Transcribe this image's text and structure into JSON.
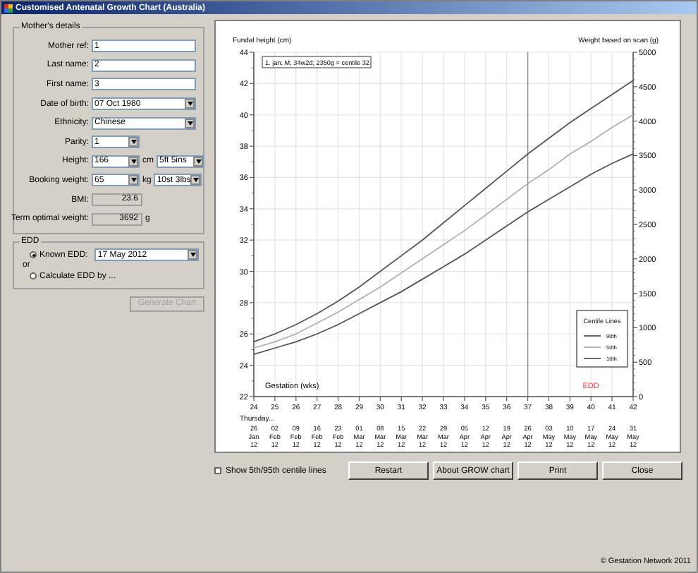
{
  "window": {
    "title": "Customised Antenatal Growth Chart (Australia)"
  },
  "mothers_details": {
    "title": "Mother's details",
    "fields": [
      {
        "kind": "text",
        "label": "Mother ref:",
        "value": "1"
      },
      {
        "kind": "text",
        "label": "Last name:",
        "value": "2"
      },
      {
        "kind": "text",
        "label": "First name:",
        "value": "3"
      },
      {
        "kind": "dropdown",
        "label": "Date of birth:",
        "value": "07 Oct 1980"
      },
      {
        "kind": "dropdown",
        "label": "Ethnicity:",
        "value": "Chinese"
      },
      {
        "kind": "short-dropdown",
        "label": "Parity:",
        "value": "1"
      },
      {
        "kind": "short-dropdown",
        "label": "Height:",
        "value": "166",
        "unit": "cm",
        "secondary": "5ft 5ins"
      },
      {
        "kind": "short-dropdown",
        "label": "Booking weight:",
        "value": "65",
        "unit": "kg",
        "secondary": "10st 3lbs"
      },
      {
        "kind": "readonly",
        "label": "BMI:",
        "value": "23.6"
      },
      {
        "kind": "readonly",
        "label": "Term optimal weight:",
        "value": "3692",
        "unit": "g"
      }
    ]
  },
  "edd": {
    "title": "EDD",
    "separator": "or",
    "options": [
      {
        "label": "Known EDD:",
        "selected": true,
        "value": "17 May 2012"
      },
      {
        "label": "Calculate EDD by ...",
        "selected": false
      }
    ]
  },
  "generate_button": {
    "label": "Generate Chart",
    "disabled": true
  },
  "chart": {
    "right_axis": {
      "label": "Weight based on scan (g)",
      "ticks": [
        "5000",
        "4500",
        "4000",
        "3500",
        "3000",
        "2500",
        "2000",
        "1500",
        "1000",
        "500",
        "0"
      ]
    },
    "legend_title": "Centile Lines",
    "dates_label": "Thursday...",
    "dates": [
      {
        "day": "26",
        "month": "Jan",
        "year": "12"
      },
      {
        "day": "02",
        "month": "Feb",
        "year": "12"
      },
      {
        "day": "09",
        "month": "Feb",
        "year": "12"
      },
      {
        "day": "16",
        "month": "Feb",
        "year": "12"
      },
      {
        "day": "23",
        "month": "Feb",
        "year": "12"
      },
      {
        "day": "01",
        "month": "Mar",
        "year": "12"
      },
      {
        "day": "08",
        "month": "Mar",
        "year": "12"
      },
      {
        "day": "15",
        "month": "Mar",
        "year": "12"
      },
      {
        "day": "22",
        "month": "Mar",
        "year": "12"
      },
      {
        "day": "29",
        "month": "Mar",
        "year": "12"
      },
      {
        "day": "05",
        "month": "Apr",
        "year": "12"
      },
      {
        "day": "12",
        "month": "Apr",
        "year": "12"
      },
      {
        "day": "19",
        "month": "Apr",
        "year": "12"
      },
      {
        "day": "26",
        "month": "Apr",
        "year": "12"
      },
      {
        "day": "03",
        "month": "May",
        "year": "12"
      },
      {
        "day": "10",
        "month": "May",
        "year": "12"
      },
      {
        "day": "17",
        "month": "May",
        "year": "12"
      },
      {
        "day": "24",
        "month": "May",
        "year": "12"
      },
      {
        "day": "31",
        "month": "May",
        "year": "12"
      }
    ],
    "chart_data": {
      "type": "line",
      "xlabel": "Gestation (wks)",
      "ylabel": "Fundal height (cm)",
      "x": [
        24,
        25,
        26,
        27,
        28,
        29,
        30,
        31,
        32,
        33,
        34,
        35,
        36,
        37,
        38,
        39,
        40,
        41,
        42
      ],
      "series": [
        {
          "name": "90th",
          "color": "#555555",
          "values": [
            25.5,
            26.0,
            26.6,
            27.3,
            28.1,
            29.0,
            30.0,
            31.0,
            32.0,
            33.1,
            34.2,
            35.3,
            36.4,
            37.5,
            38.5,
            39.5,
            40.4,
            41.3,
            42.2
          ]
        },
        {
          "name": "50th",
          "color": "#b0b0b0",
          "values": [
            25.1,
            25.5,
            26.0,
            26.7,
            27.4,
            28.2,
            29.0,
            29.9,
            30.8,
            31.7,
            32.6,
            33.6,
            34.6,
            35.6,
            36.5,
            37.5,
            38.3,
            39.2,
            40.0
          ]
        },
        {
          "name": "10th",
          "color": "#555555",
          "values": [
            24.7,
            25.1,
            25.5,
            26.0,
            26.6,
            27.3,
            28.0,
            28.7,
            29.5,
            30.3,
            31.1,
            32.0,
            32.9,
            33.8,
            34.6,
            35.4,
            36.2,
            36.9,
            37.5
          ]
        }
      ],
      "xlim": [
        24,
        42
      ],
      "ylim": [
        22,
        44
      ],
      "xticks": [
        24,
        25,
        26,
        27,
        28,
        29,
        30,
        31,
        32,
        33,
        34,
        35,
        36,
        37,
        38,
        39,
        40,
        41,
        42
      ],
      "yticks": [
        22,
        24,
        26,
        28,
        30,
        32,
        34,
        36,
        38,
        40,
        42,
        44
      ],
      "ref_lines": [
        {
          "axis": "x",
          "value": 37
        }
      ],
      "grid": true,
      "legend": true,
      "annotations": [
        "1. jan; M; 34w2d; 2350g = centile 32",
        "EDD"
      ]
    }
  },
  "centile_checkbox": {
    "label": "Show 5th/95th centile lines",
    "checked": false
  },
  "buttons": [
    "Restart",
    "About GROW chart",
    "Print",
    "Close"
  ],
  "footer": "© Gestation Network 2011"
}
